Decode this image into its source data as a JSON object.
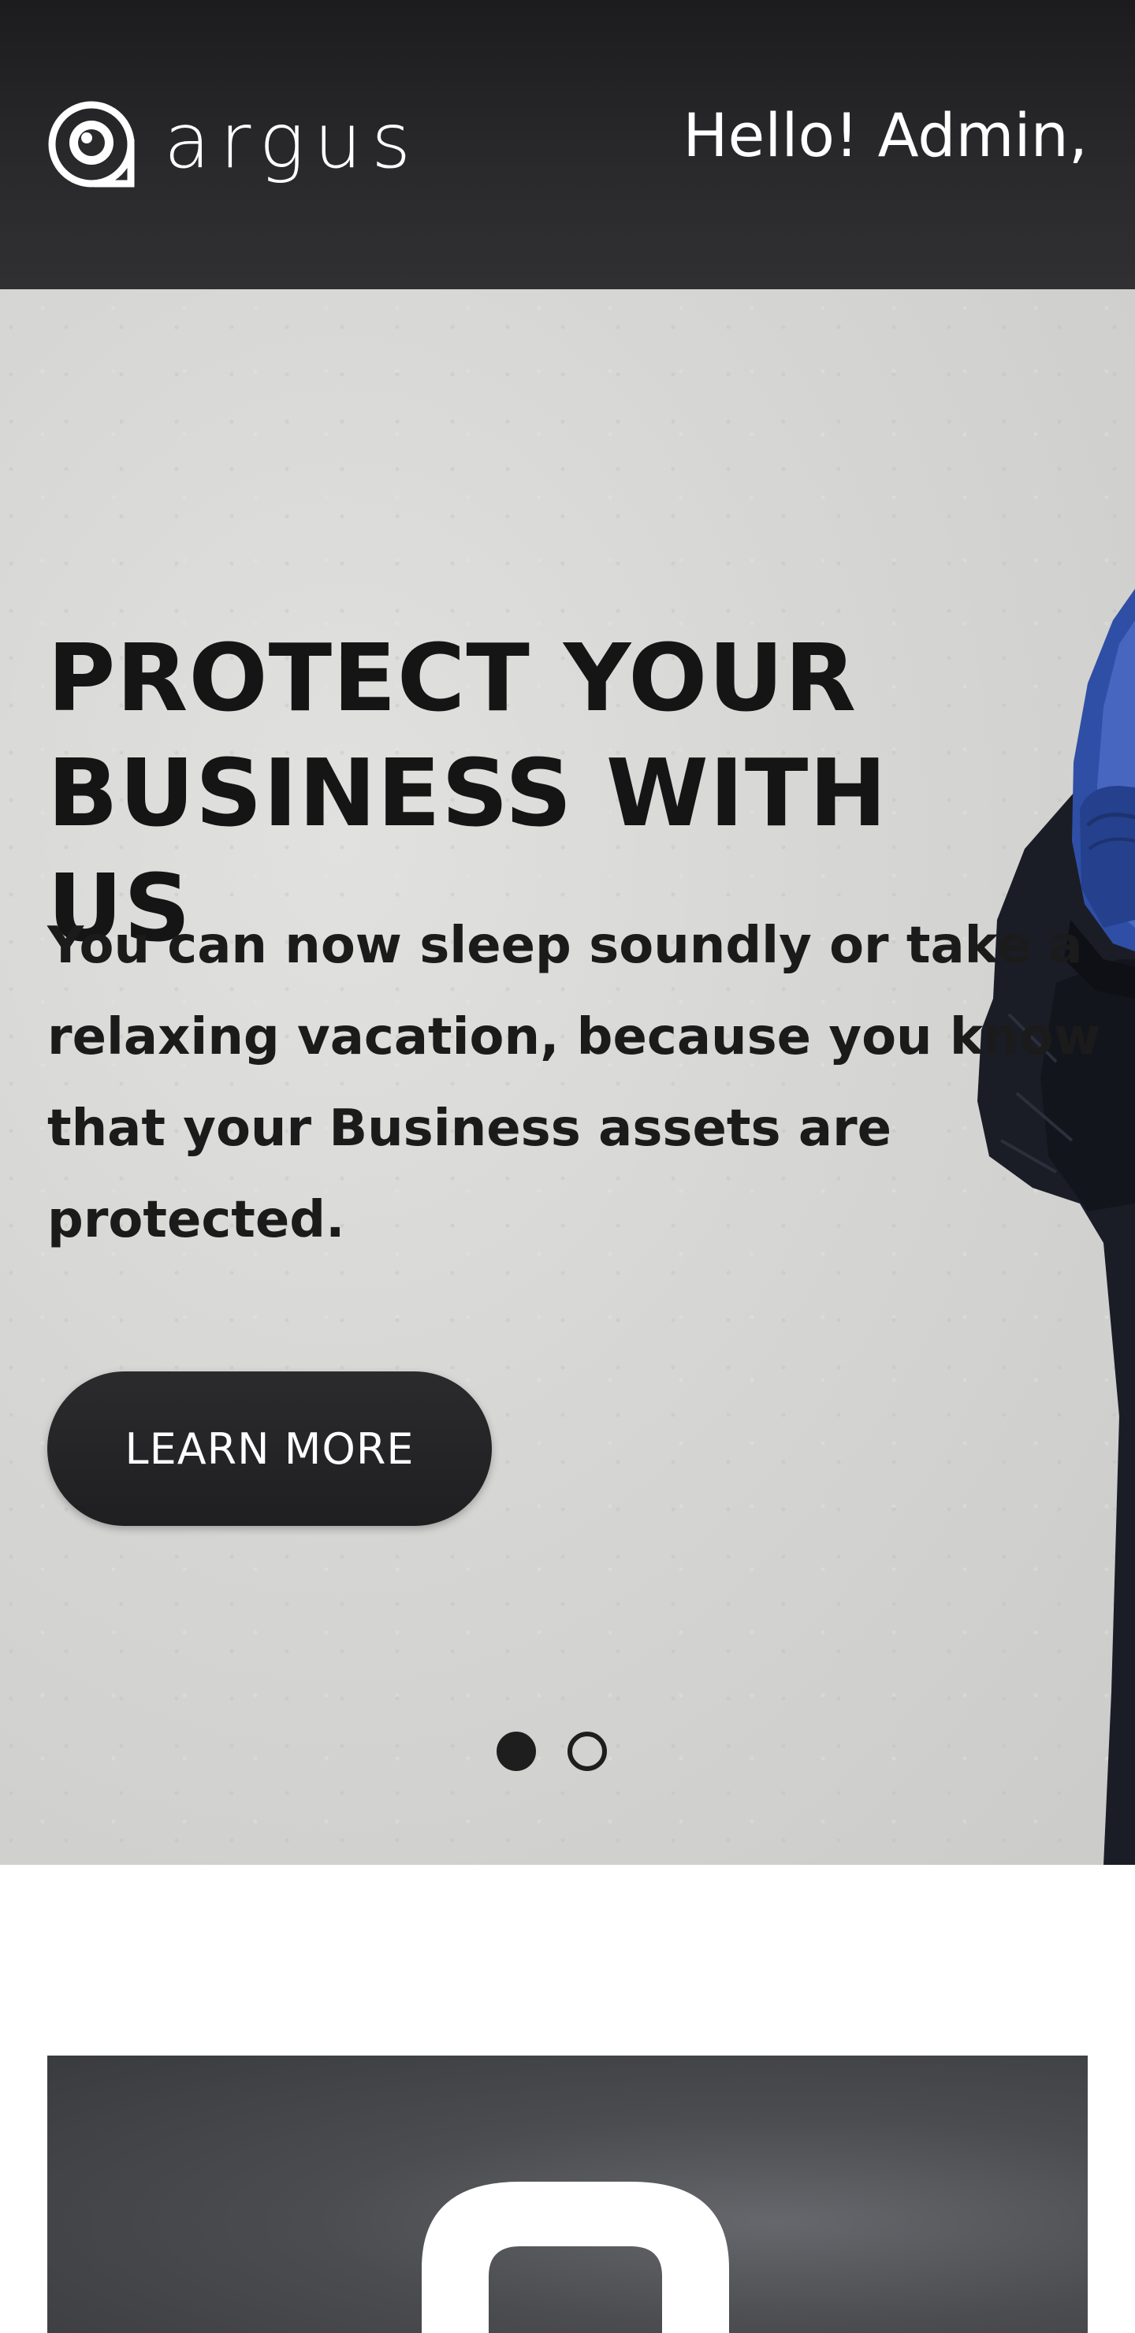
{
  "header": {
    "logo_text": "argus",
    "logo_icon": "eye-at-icon",
    "greeting": "Hello! Admin,"
  },
  "hero": {
    "title_line1": "PROTECT YOUR",
    "title_line2": "BUSINESS WITH US",
    "body": "You can now sleep soundly or take a relaxing vacation, because you know that your Business assets are protected.",
    "cta_label": "LEARN MORE",
    "slides": {
      "total": 2,
      "active": 1
    }
  },
  "feature": {
    "icon": "padlock-icon"
  },
  "colors": {
    "header_bg": "#1c1c1e",
    "hero_bg": "#d6d6d4",
    "cta_bg": "#2b2b2d",
    "text_dark": "#151515",
    "glove_blue": "#2f4fa6",
    "feature_bg": "#4b4c50"
  }
}
